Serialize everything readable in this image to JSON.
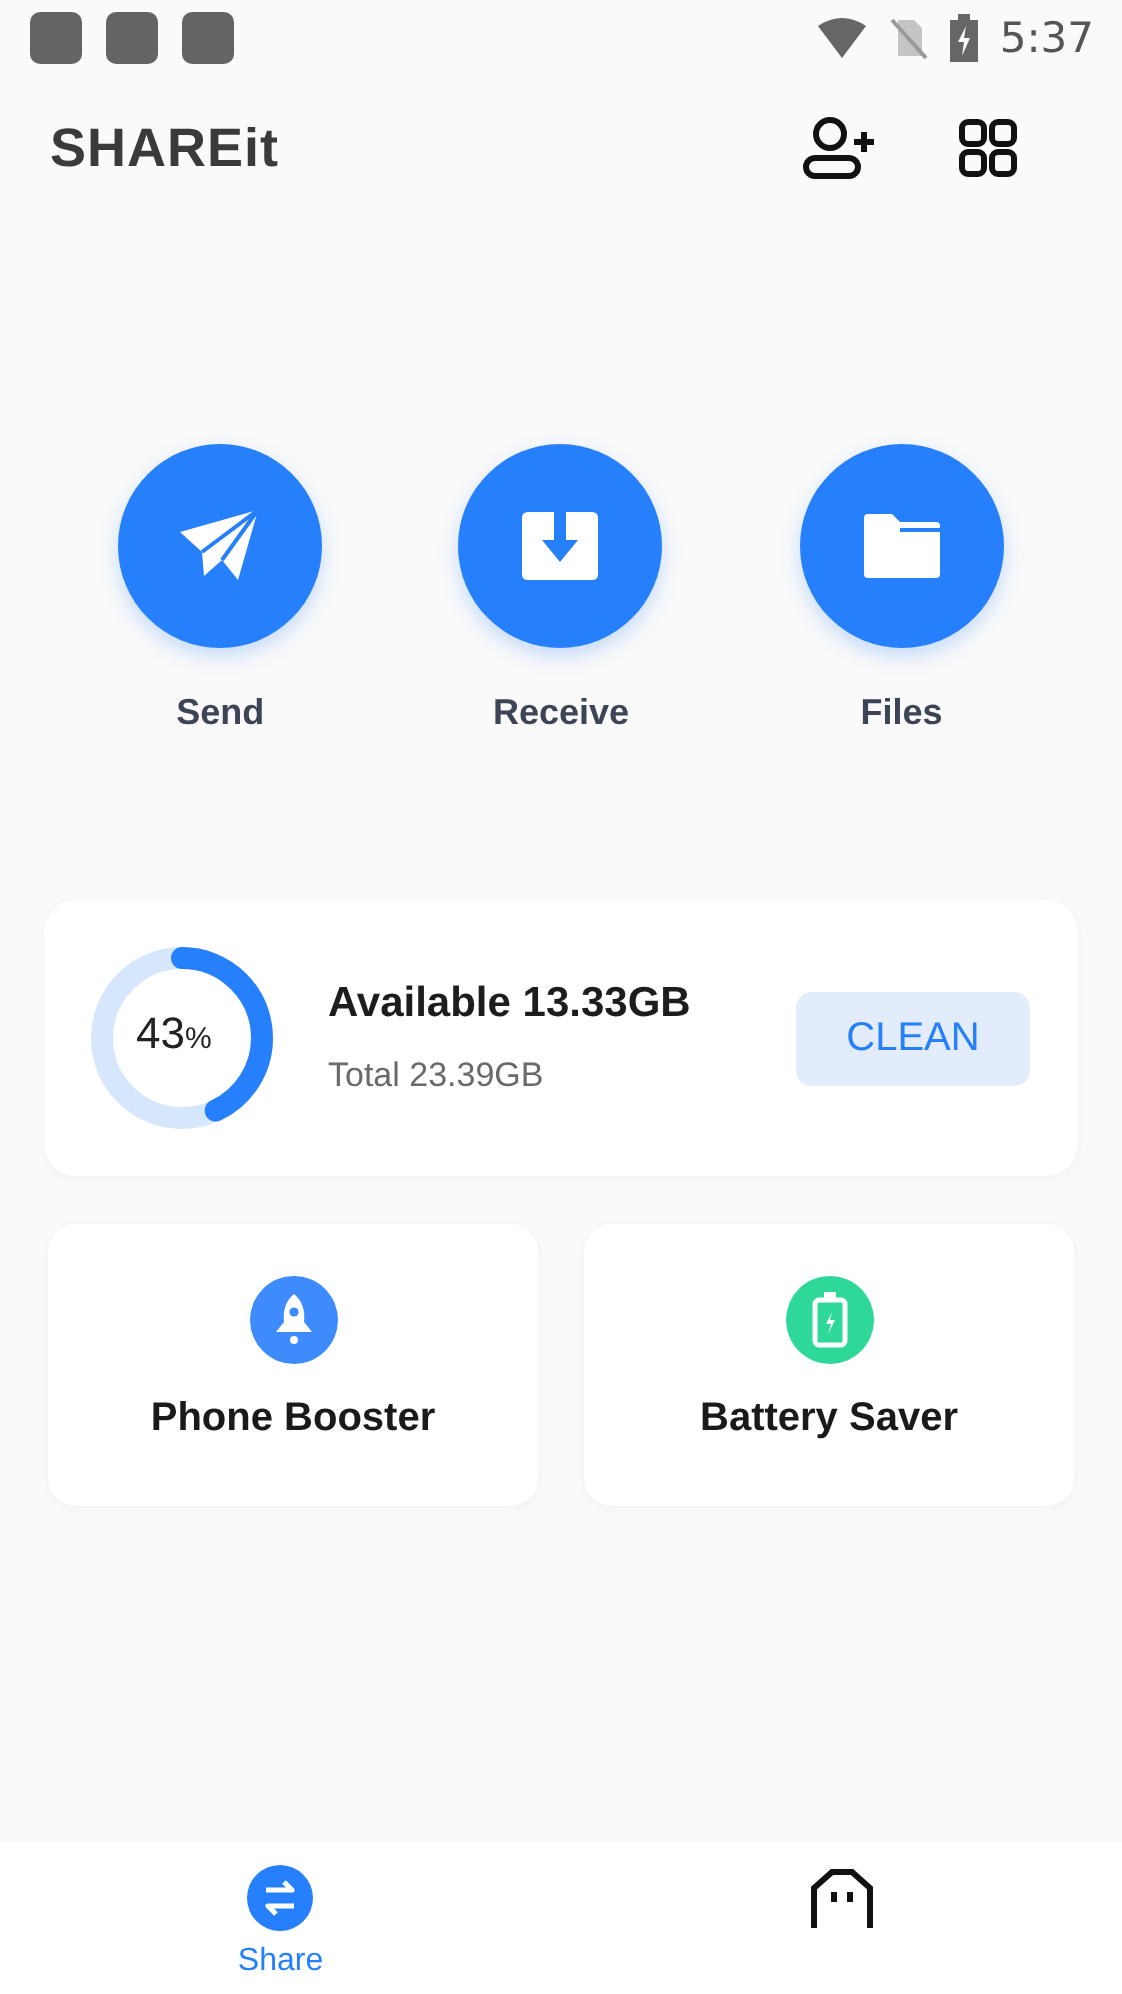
{
  "status_bar": {
    "time": "5:37"
  },
  "header": {
    "logo": "SHAREit"
  },
  "actions": [
    {
      "kind": "send",
      "label": "Send"
    },
    {
      "kind": "receive",
      "label": "Receive"
    },
    {
      "kind": "files",
      "label": "Files"
    }
  ],
  "storage": {
    "percent": "43",
    "percent_sign": "%",
    "level": 0.43,
    "available": "Available 13.33GB",
    "total": "Total 23.39GB",
    "button": "CLEAN"
  },
  "tools": [
    {
      "kind": "booster",
      "label": "Phone Booster",
      "color": "#3d8bfd"
    },
    {
      "kind": "battery",
      "label": "Battery Saver",
      "color": "#2ed899"
    }
  ],
  "bottom_nav": [
    {
      "kind": "share",
      "label": "Share",
      "selected": true
    },
    {
      "kind": "me",
      "selected": false
    }
  ]
}
